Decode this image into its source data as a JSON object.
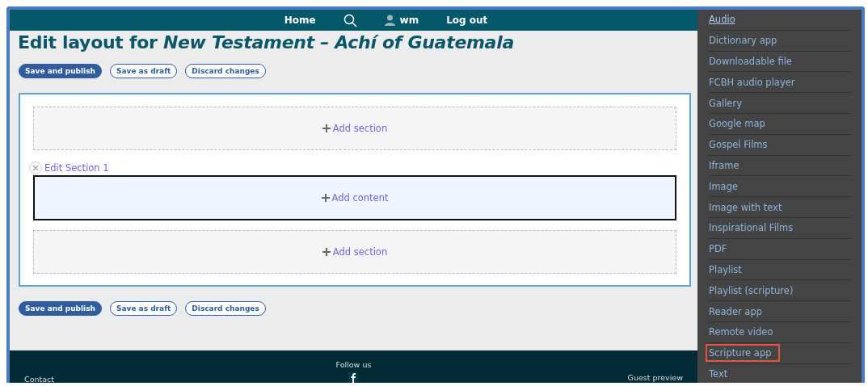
{
  "header": {
    "nav": [
      {
        "kind": "link",
        "label": "Home"
      },
      {
        "kind": "search"
      },
      {
        "kind": "user",
        "label": "wm"
      },
      {
        "kind": "link",
        "label": "Log out"
      }
    ]
  },
  "title": "Edit layout for *New Testament – Achí of Guatemala*",
  "actions_top": [
    {
      "label": "Save and publish",
      "primary": true
    },
    {
      "label": "Save as draft",
      "primary": false
    },
    {
      "label": "Discard changes",
      "primary": false
    }
  ],
  "layout": [
    {
      "kind": "add_section",
      "label": "Add section"
    },
    {
      "kind": "section",
      "title": "Edit Section 1",
      "label": "Add content"
    },
    {
      "kind": "add_section",
      "label": "Add section"
    }
  ],
  "actions_bottom": [
    {
      "label": "Save and publish",
      "primary": true
    },
    {
      "label": "Save as draft",
      "primary": false
    },
    {
      "label": "Discard changes",
      "primary": false
    }
  ],
  "footer": {
    "contact": "Contact",
    "follow": "Follow us",
    "preview": "Guest preview"
  },
  "sidebar": {
    "items": [
      {
        "label": "Audio",
        "selected": true,
        "highlighted": false
      },
      {
        "label": "Dictionary app",
        "selected": false,
        "highlighted": false
      },
      {
        "label": "Downloadable file",
        "selected": false,
        "highlighted": false
      },
      {
        "label": "FCBH audio player",
        "selected": false,
        "highlighted": false
      },
      {
        "label": "Gallery",
        "selected": false,
        "highlighted": false
      },
      {
        "label": "Google map",
        "selected": false,
        "highlighted": false
      },
      {
        "label": "Gospel Films",
        "selected": false,
        "highlighted": false
      },
      {
        "label": "Iframe",
        "selected": false,
        "highlighted": false
      },
      {
        "label": "Image",
        "selected": false,
        "highlighted": false
      },
      {
        "label": "Image with text",
        "selected": false,
        "highlighted": false
      },
      {
        "label": "Inspirational Films",
        "selected": false,
        "highlighted": false
      },
      {
        "label": "PDF",
        "selected": false,
        "highlighted": false
      },
      {
        "label": "Playlist",
        "selected": false,
        "highlighted": false
      },
      {
        "label": "Playlist (scripture)",
        "selected": false,
        "highlighted": false
      },
      {
        "label": "Reader app",
        "selected": false,
        "highlighted": false
      },
      {
        "label": "Remote video",
        "selected": false,
        "highlighted": false
      },
      {
        "label": "Scripture app",
        "selected": false,
        "highlighted": true
      },
      {
        "label": "Text",
        "selected": false,
        "highlighted": false
      }
    ]
  }
}
